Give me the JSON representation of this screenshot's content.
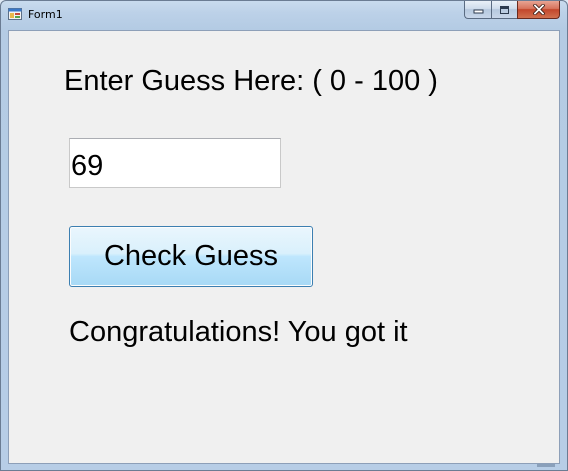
{
  "window": {
    "title": "Form1",
    "icons": {
      "app": "form-app-icon",
      "minimize": "minimize-icon",
      "maximize": "maximize-icon",
      "close": "close-icon"
    }
  },
  "form": {
    "prompt_label": "Enter Guess Here: ( 0 - 100 )",
    "guess_value": "69",
    "check_button_label": "Check Guess",
    "result_label": "Congratulations! You got it"
  }
}
